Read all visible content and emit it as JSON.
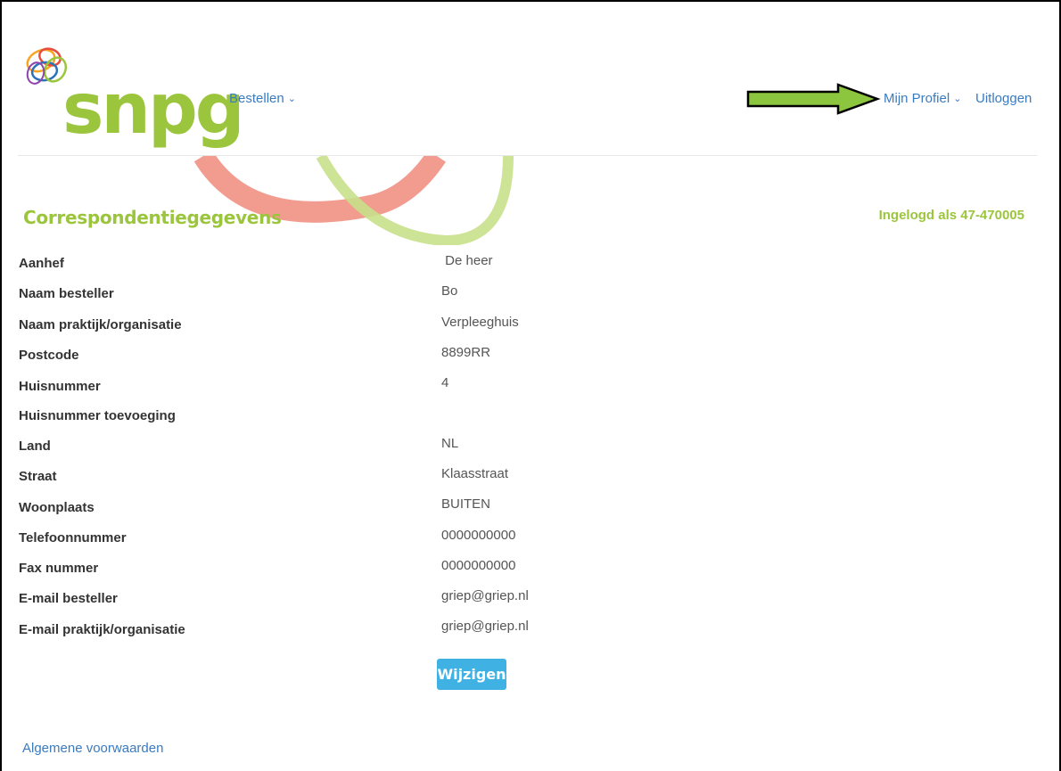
{
  "brand": {
    "logo_text": "snpg",
    "accent": "#9bc53d",
    "link_color": "#3a7bbf",
    "button_color": "#3fb1e3"
  },
  "nav": {
    "bestellen": "Bestellen",
    "mijn_profiel": "Mijn Profiel",
    "uitloggen": "Uitloggen",
    "chevron_icon": "chevron-down-icon",
    "annotation": "green-arrow-pointing-right"
  },
  "page": {
    "title": "Correspondentiegegevens",
    "logged_in": "Ingelogd als 47-470005"
  },
  "fields": [
    {
      "label": "Aanhef",
      "value": " De heer"
    },
    {
      "label": "Naam besteller",
      "value": "Bo"
    },
    {
      "label": "Naam praktijk/organisatie",
      "value": "Verpleeghuis"
    },
    {
      "label": "Postcode",
      "value": "8899RR"
    },
    {
      "label": "Huisnummer",
      "value": "4"
    },
    {
      "label": "Huisnummer toevoeging",
      "value": ""
    },
    {
      "label": "Land",
      "value": "NL"
    },
    {
      "label": "Straat",
      "value": "Klaasstraat"
    },
    {
      "label": "Woonplaats",
      "value": "BUITEN"
    },
    {
      "label": "Telefoonnummer",
      "value": "0000000000"
    },
    {
      "label": "Fax nummer",
      "value": "0000000000"
    },
    {
      "label": "E-mail besteller",
      "value": "griep@griep.nl"
    },
    {
      "label": "E-mail praktijk/organisatie",
      "value": "griep@griep.nl"
    }
  ],
  "actions": {
    "edit_label": "Wijzigen"
  },
  "footer": {
    "terms": "Algemene voorwaarden"
  }
}
